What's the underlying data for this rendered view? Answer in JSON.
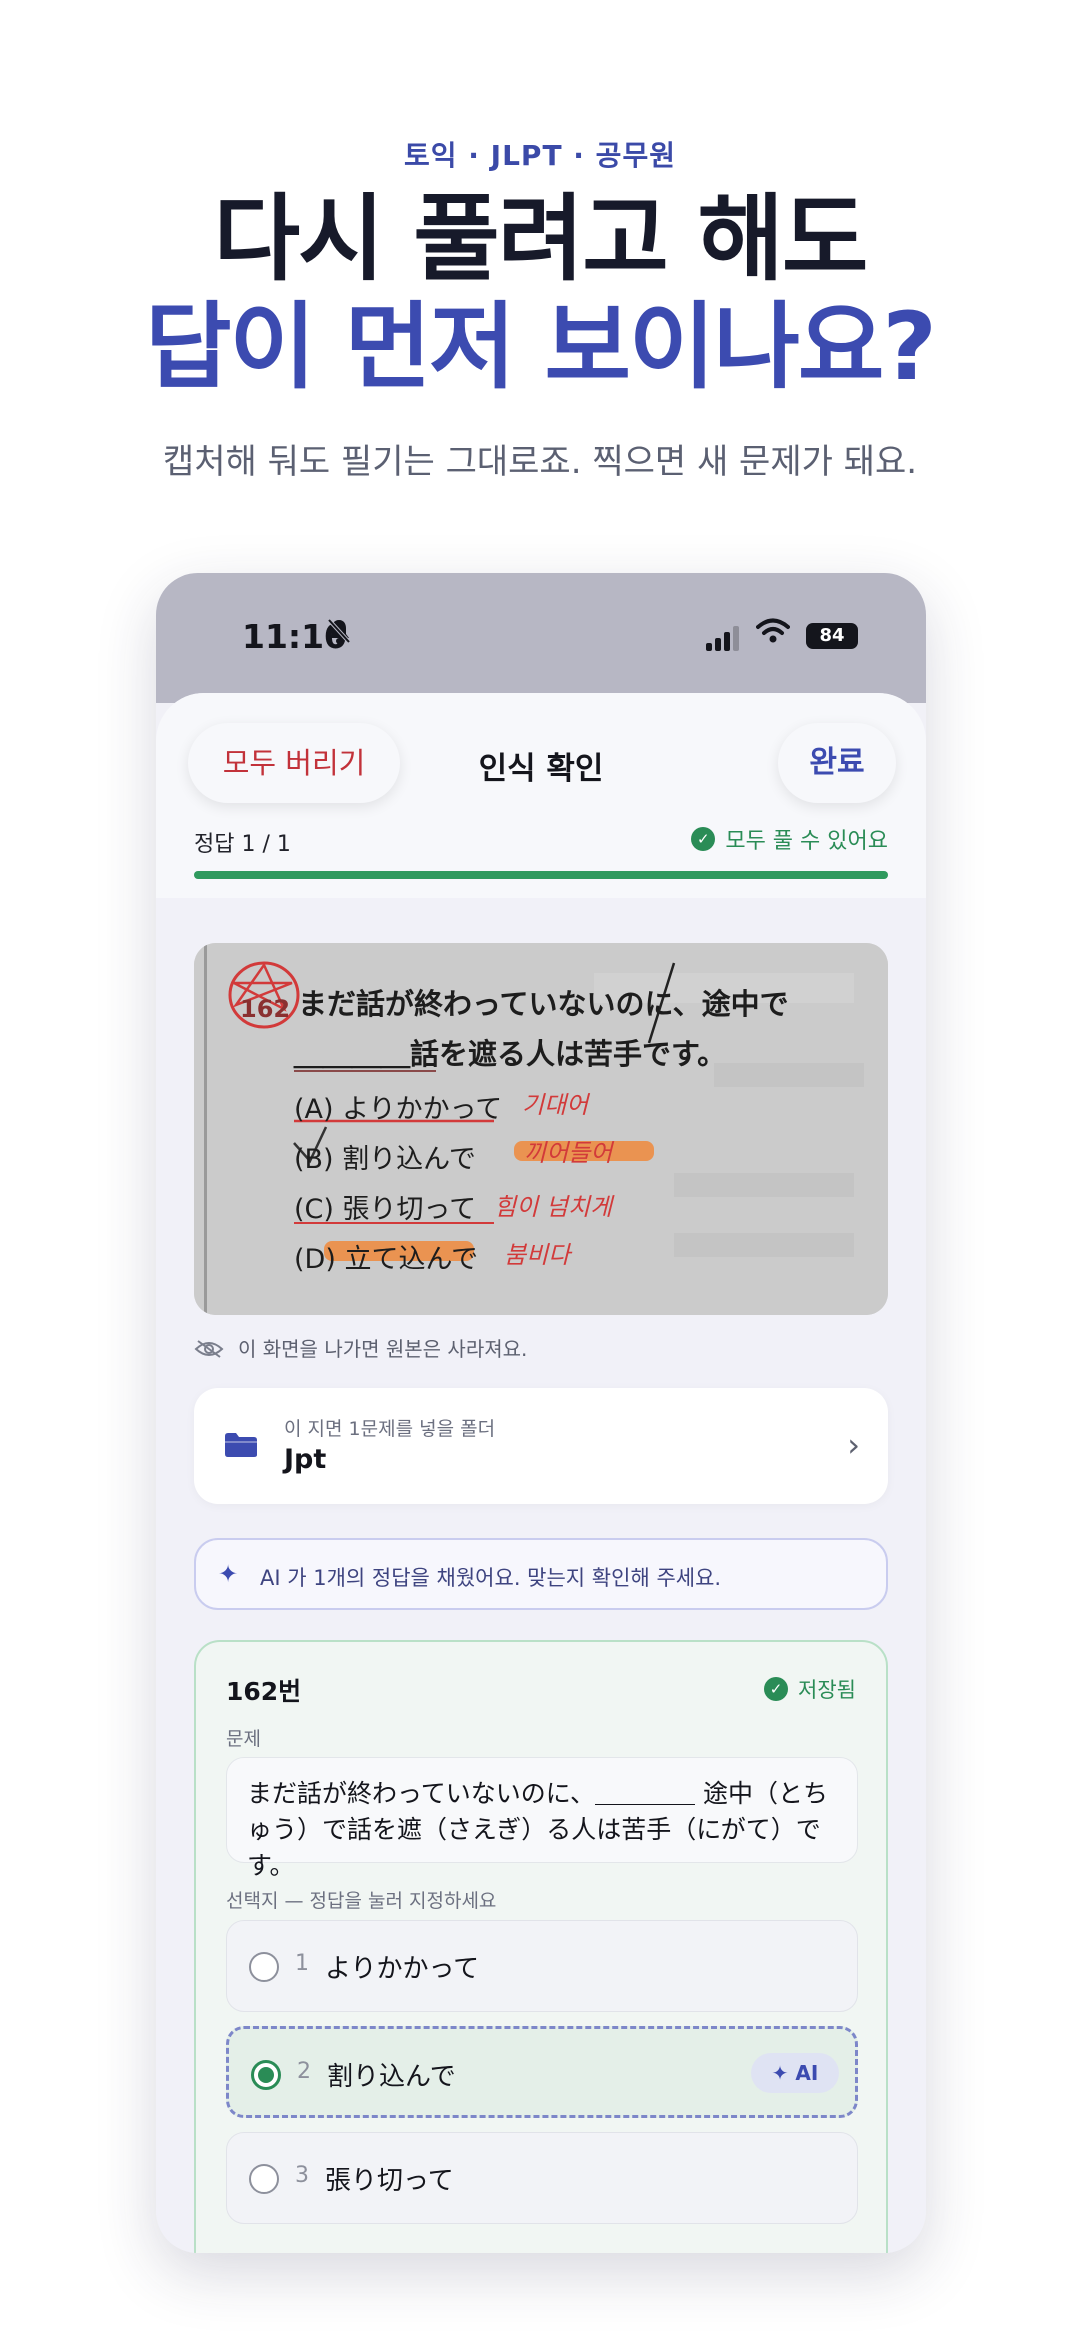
{
  "hero": {
    "tagline": "토익 · JLPT · 공무원",
    "headline_line1": "다시 풀려고 해도",
    "headline_line2": "답이 먼저 보이나요?",
    "subtitle": "캡처해 둬도 필기는 그대로죠. 찍으면 새 문제가 돼요."
  },
  "status_bar": {
    "time": "11:10",
    "battery": "84",
    "icons": [
      "bell-muted-icon",
      "signal-icon",
      "wifi-icon",
      "battery-icon"
    ]
  },
  "header": {
    "discard_label": "모두 버리기",
    "title": "인식 확인",
    "done_label": "완료",
    "answer_count": "정답 1 / 1",
    "status_text": "모두 풀 수 있어요",
    "progress": 1.0
  },
  "photo": {
    "number": "162",
    "line1": "まだ話が終わっていないのに、途中で",
    "line2": "＿＿＿＿話を遮る人は苦手です。",
    "options": [
      "(A) よりかかって",
      "(B) 割り込んで",
      "(C) 張り切って",
      "(D) 立て込んで"
    ],
    "notes": [
      "기대어",
      "끼어들어",
      "힘이 넘치게",
      "붐비다"
    ]
  },
  "hint": {
    "text": "이 화면을 나가면 원본은 사라져요."
  },
  "folder": {
    "caption": "이 지면 1문제를 넣을 폴더",
    "name": "Jpt"
  },
  "ai_banner": {
    "text": "AI 가 1개의 정답을 채웠어요. 맞는지 확인해 주세요."
  },
  "question": {
    "number_label": "162번",
    "saved_label": "저장됨",
    "problem_label": "문제",
    "problem_text": "まだ話が終わっていないのに、＿＿＿＿ 途中（とちゅう）で話を遮（さえぎ）る人は苦手（にがて）です。",
    "choices_label": "선택지 — 정답을 눌러 지정하세요",
    "choices": [
      {
        "num": "1",
        "text": "よりかかって",
        "selected": false
      },
      {
        "num": "2",
        "text": "割り込んで",
        "selected": true,
        "badge": "AI"
      },
      {
        "num": "3",
        "text": "張り切って",
        "selected": false
      }
    ]
  },
  "colors": {
    "accent": "#3c4bb0",
    "danger": "#c2323a",
    "success": "#2a8c56",
    "highlight": "#f08a3c",
    "red_pen": "#d23a3a"
  }
}
